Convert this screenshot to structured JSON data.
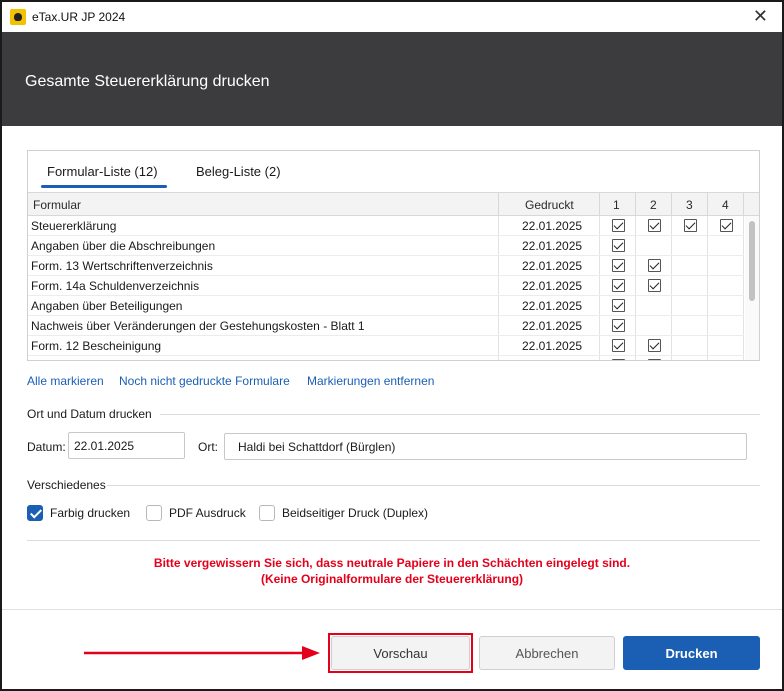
{
  "window": {
    "title": "eTax.UR JP 2024",
    "close_glyph": "✕"
  },
  "header": {
    "title": "Gesamte Steuererklärung drucken"
  },
  "tabs": [
    {
      "label": "Formular-Liste",
      "count": "(12)",
      "active": true
    },
    {
      "label": "Beleg-Liste",
      "count": "(2)",
      "active": false
    }
  ],
  "table": {
    "headers": {
      "formular": "Formular",
      "gedruckt": "Gedruckt",
      "c1": "1",
      "c2": "2",
      "c3": "3",
      "c4": "4"
    },
    "rows": [
      {
        "name": "Steuererklärung",
        "date": "22.01.2025",
        "checks": [
          true,
          true,
          true,
          true
        ]
      },
      {
        "name": "Angaben über die Abschreibungen",
        "date": "22.01.2025",
        "checks": [
          true,
          false,
          false,
          false
        ]
      },
      {
        "name": "Form. 13 Wertschriftenverzeichnis",
        "date": "22.01.2025",
        "checks": [
          true,
          true,
          false,
          false
        ]
      },
      {
        "name": "Form. 14a Schuldenverzeichnis",
        "date": "22.01.2025",
        "checks": [
          true,
          true,
          false,
          false
        ]
      },
      {
        "name": "Angaben über Beteiligungen",
        "date": "22.01.2025",
        "checks": [
          true,
          false,
          false,
          false
        ]
      },
      {
        "name": "Nachweis über Veränderungen der Gestehungskosten - Blatt 1",
        "date": "22.01.2025",
        "checks": [
          true,
          false,
          false,
          false
        ]
      },
      {
        "name": "Form. 12 Bescheinigung",
        "date": "22.01.2025",
        "checks": [
          true,
          true,
          false,
          false
        ]
      },
      {
        "name": "",
        "date": "",
        "checks": [
          true,
          true,
          false,
          false
        ]
      }
    ]
  },
  "links": {
    "mark_all": "Alle markieren",
    "mark_unprinted": "Noch nicht gedruckte Formulare",
    "remove_marks": "Markierungen entfernen"
  },
  "place_date": {
    "section": "Ort und Datum drucken",
    "date_label": "Datum:",
    "date_value": "22.01.2025",
    "place_label": "Ort:",
    "place_value": "Haldi bei Schattdorf (Bürglen)"
  },
  "misc": {
    "section": "Verschiedenes",
    "options": [
      {
        "label": "Farbig drucken",
        "checked": true
      },
      {
        "label": "PDF Ausdruck",
        "checked": false
      },
      {
        "label": "Beidseitiger Druck (Duplex)",
        "checked": false
      }
    ]
  },
  "warning": {
    "line1": "Bitte vergewissern Sie sich, dass neutrale Papiere in den Schächten eingelegt sind.",
    "line2": "(Keine Originalformulare der Steuererklärung)"
  },
  "buttons": {
    "preview": "Vorschau",
    "cancel": "Abbrechen",
    "print": "Drucken"
  },
  "colors": {
    "accent": "#1a5fb4",
    "header_bg": "#3c3c3e",
    "warning": "#e3001b"
  }
}
